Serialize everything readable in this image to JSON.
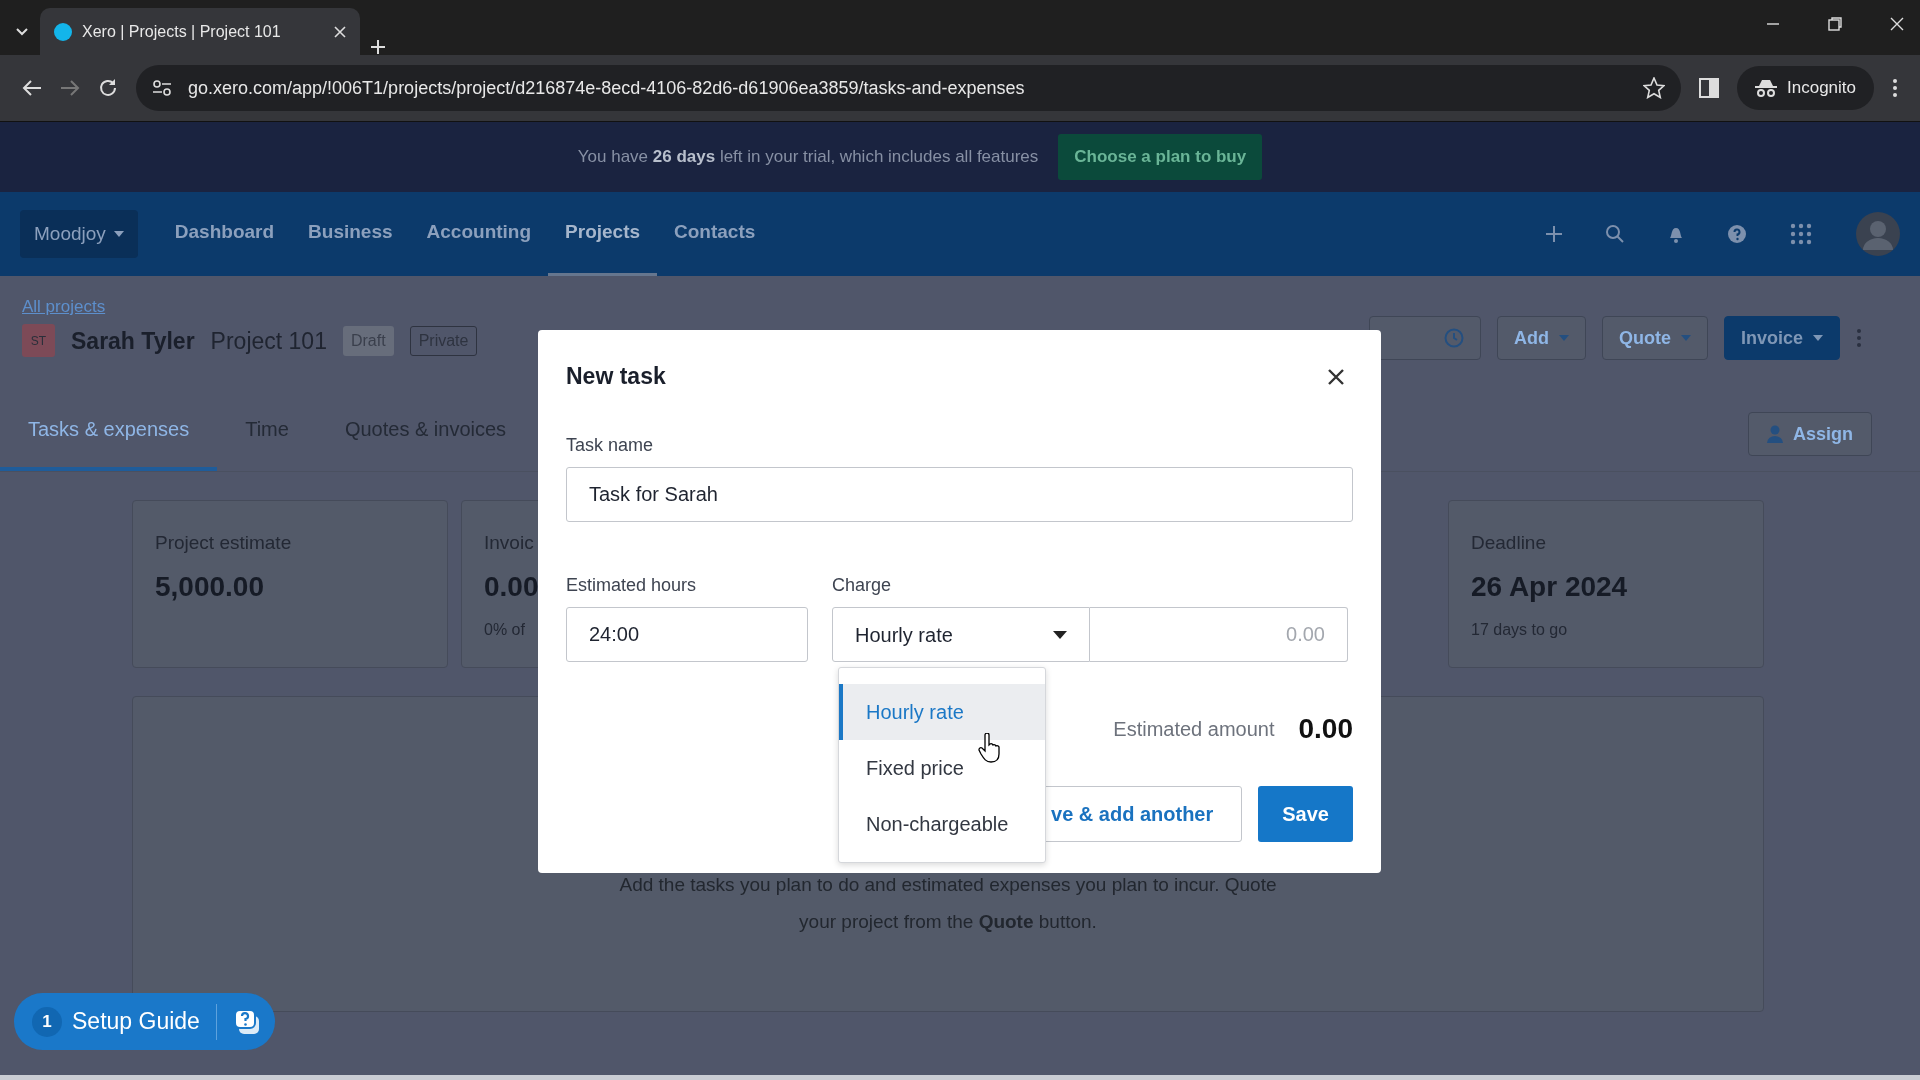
{
  "browser": {
    "tab_title": "Xero | Projects | Project 101",
    "url": "go.xero.com/app/!006T1/projects/project/d216874e-8ecd-4106-82d6-d61906ea3859/tasks-and-expenses",
    "profile": "Incognito"
  },
  "trial_banner": {
    "text": "You have **26 days** left in your trial, which includes all features",
    "button": "Choose a plan to buy"
  },
  "nav": {
    "organisation": "Moodjoy",
    "items": [
      {
        "label": "Dashboard",
        "selected": false
      },
      {
        "label": "Business",
        "selected": false
      },
      {
        "label": "Accounting",
        "selected": false
      },
      {
        "label": "Projects",
        "selected": true
      },
      {
        "label": "Contacts",
        "selected": false
      }
    ]
  },
  "project": {
    "breadcrumb": "All projects",
    "initials": "ST",
    "client": "Sarah Tyler",
    "name": "Project 101",
    "badges": [
      {
        "label": "Draft",
        "kind": "filled"
      },
      {
        "label": "Private",
        "kind": "outline"
      }
    ],
    "actions": [
      {
        "kind": "icon"
      },
      {
        "label": "Add",
        "kind": "dropdown"
      },
      {
        "label": "Quote",
        "kind": "dropdown"
      },
      {
        "label": "Invoice",
        "kind": "primary"
      }
    ]
  },
  "tabs": [
    {
      "label": "Tasks & expenses",
      "selected": true
    },
    {
      "label": "Time",
      "selected": false
    },
    {
      "label": "Quotes & invoices",
      "selected": false
    }
  ],
  "assign_button": "Assign",
  "cards": [
    {
      "title": "Project estimate",
      "value": "5,000.00"
    },
    {
      "title": "Invoic",
      "value": "0.00",
      "note": "0% of"
    },
    {
      "title": "Deadline",
      "value": "26 Apr 2024",
      "note": "17 days to go"
    }
  ],
  "empty_state": {
    "line_1": "Add the tasks you plan to do and estimated expenses you plan to incur. Quote",
    "line_2": "your project from the **Quote** button."
  },
  "modal": {
    "title": "New task",
    "task_name": {
      "label": "Task name",
      "value": "Task for Sarah"
    },
    "estimated_hours": {
      "label": "Estimated hours",
      "value": "24:00"
    },
    "charge": {
      "label": "Charge",
      "value": "Hourly rate",
      "rate_placeholder": "0.00"
    },
    "charge_options": [
      {
        "label": "Hourly rate",
        "selected": true
      },
      {
        "label": "Fixed price",
        "selected": false
      },
      {
        "label": "Non-chargeable",
        "selected": false
      }
    ],
    "estimated_amount": {
      "label": "Estimated amount",
      "value": "0.00"
    },
    "buttons": [
      {
        "label": "ve & add another",
        "kind": "secondary"
      },
      {
        "label": "Save",
        "kind": "primary"
      }
    ]
  },
  "setup_guide": {
    "count": "1",
    "label": "Setup Guide"
  }
}
